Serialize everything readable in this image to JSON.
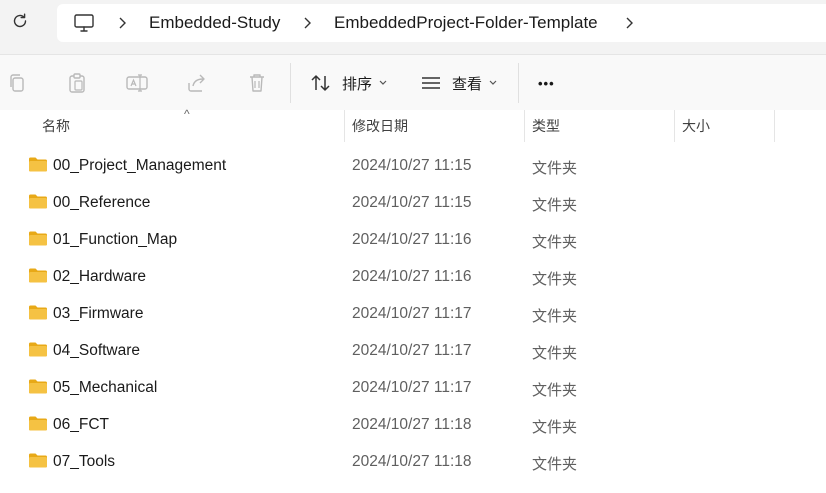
{
  "breadcrumb": {
    "items": [
      "Embedded-Study",
      "EmbeddedProject-Folder-Template"
    ]
  },
  "toolbar": {
    "sort_label": "排序",
    "view_label": "查看",
    "more_label": "•••"
  },
  "columns": {
    "name": "名称",
    "date": "修改日期",
    "type": "类型",
    "size": "大小"
  },
  "rows": [
    {
      "name": "00_Project_Management",
      "date": "2024/10/27 11:15",
      "type": "文件夹"
    },
    {
      "name": "00_Reference",
      "date": "2024/10/27 11:15",
      "type": "文件夹"
    },
    {
      "name": "01_Function_Map",
      "date": "2024/10/27 11:16",
      "type": "文件夹"
    },
    {
      "name": "02_Hardware",
      "date": "2024/10/27 11:16",
      "type": "文件夹"
    },
    {
      "name": "03_Firmware",
      "date": "2024/10/27 11:17",
      "type": "文件夹"
    },
    {
      "name": "04_Software",
      "date": "2024/10/27 11:17",
      "type": "文件夹"
    },
    {
      "name": "05_Mechanical",
      "date": "2024/10/27 11:17",
      "type": "文件夹"
    },
    {
      "name": "06_FCT",
      "date": "2024/10/27 11:18",
      "type": "文件夹"
    },
    {
      "name": "07_Tools",
      "date": "2024/10/27 11:18",
      "type": "文件夹"
    }
  ],
  "colors": {
    "folder": "#f5c243",
    "folder_dark": "#e8a917"
  }
}
